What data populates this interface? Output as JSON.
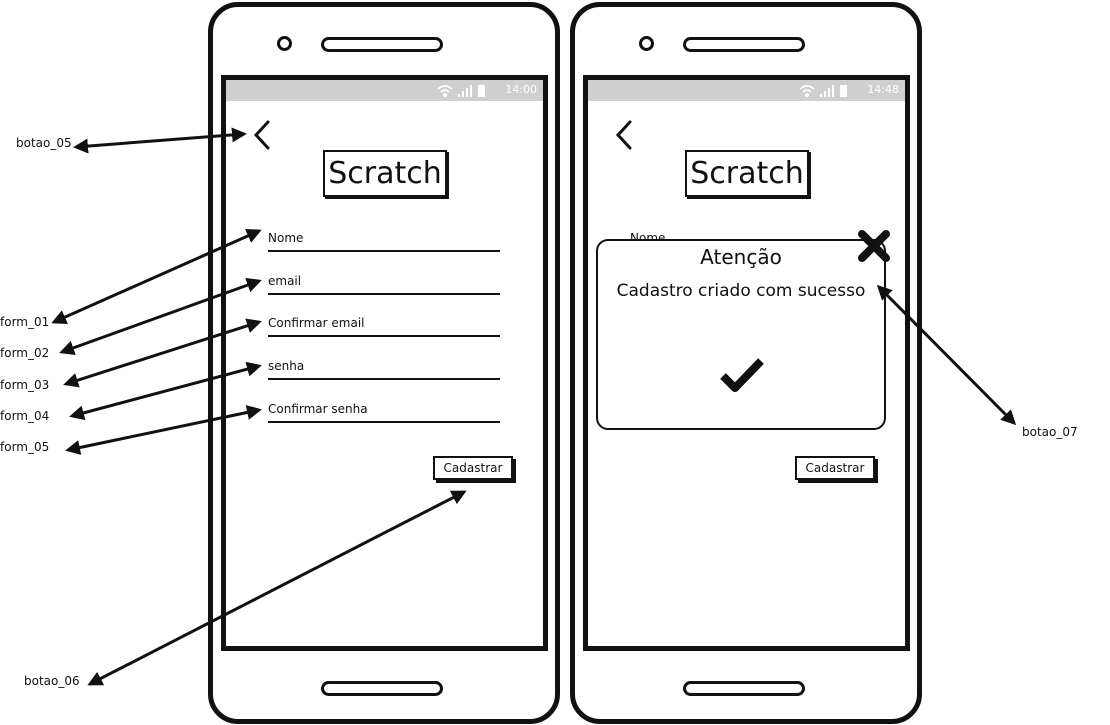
{
  "left_phone": {
    "time": "14:00",
    "logo": "Scratch",
    "fields": [
      {
        "label": "Nome"
      },
      {
        "label": "email"
      },
      {
        "label": "Confirmar email"
      },
      {
        "label": "senha"
      },
      {
        "label": "Confirmar senha"
      }
    ],
    "submit_label": "Cadastrar"
  },
  "right_phone": {
    "time": "14:48",
    "logo": "Scratch",
    "field_label": "Nome",
    "dialog": {
      "title": "Atenção",
      "message": "Cadastro criado com sucesso"
    },
    "submit_label": "Cadastrar"
  },
  "annotations": {
    "botao_05": "botao_05",
    "form_01": "form_01",
    "form_02": "form_02",
    "form_03": "form_03",
    "form_04": "form_04",
    "form_05": "form_05",
    "botao_06": "botao_06",
    "botao_07": "botao_07"
  },
  "icons": {
    "back": "chevron-left-icon",
    "close": "close-icon",
    "check": "checkmark-icon",
    "wifi": "wifi-icon",
    "signal": "signal-icon",
    "battery": "battery-icon"
  }
}
